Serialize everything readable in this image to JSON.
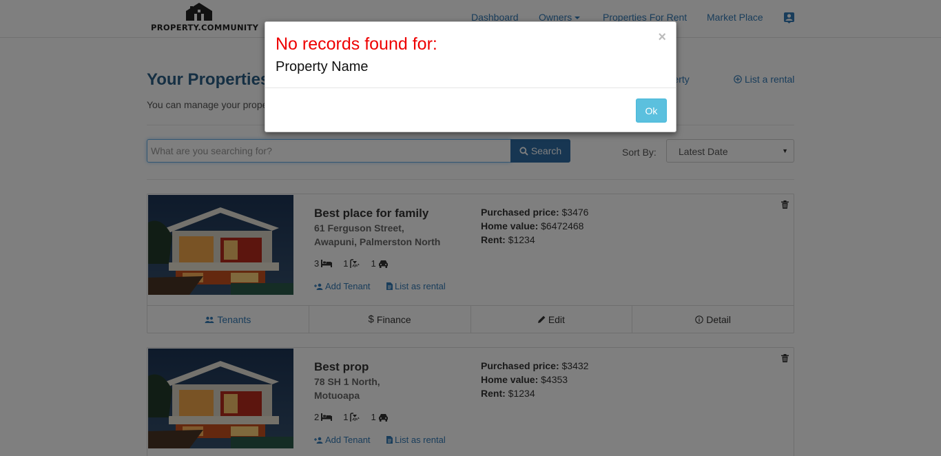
{
  "brand": {
    "logo_text": "PROPERTY.COMMUNITY"
  },
  "nav": {
    "dashboard": "Dashboard",
    "owners": "Owners",
    "properties_for_rent": "Properties For Rent",
    "market_place": "Market Place"
  },
  "header": {
    "title": "Your Properties",
    "subtitle": "You can manage your properties",
    "new_property": "New Property",
    "list_rental": "List a rental"
  },
  "search": {
    "placeholder": "What are you searching for?",
    "button": "Search",
    "sort_label": "Sort By:",
    "sort_value": "Latest Date"
  },
  "properties": [
    {
      "name": "Best place for family",
      "address_line1": "61 Ferguson Street,",
      "address_line2": "Awapuni, Palmerston North",
      "bedrooms": "3",
      "bathrooms": "1",
      "parking": "1",
      "add_tenant": "Add Tenant",
      "list_as_rental": "List as rental",
      "purchased_label": "Purchased price:",
      "purchased_value": "$3476",
      "home_value_label": "Home value:",
      "home_value": "$6472468",
      "rent_label": "Rent:",
      "rent_value": "$1234",
      "footer": {
        "tenants": "Tenants",
        "finance": "Finance",
        "edit": "Edit",
        "detail": "Detail"
      }
    },
    {
      "name": "Best prop",
      "address_line1": "78 SH 1 North,",
      "address_line2": "Motuoapa",
      "bedrooms": "2",
      "bathrooms": "1",
      "parking": "1",
      "add_tenant": "Add Tenant",
      "list_as_rental": "List as rental",
      "purchased_label": "Purchased price:",
      "purchased_value": "$3432",
      "home_value_label": "Home value:",
      "home_value": "$4353",
      "rent_label": "Rent:",
      "rent_value": "$1234"
    }
  ],
  "modal": {
    "title": "No records found for:",
    "body": "Property Name",
    "close": "×",
    "ok": "Ok"
  },
  "colors": {
    "accent": "#337ab7",
    "search_button": "#2e6da4",
    "ok_button": "#5bc0de",
    "alert_red": "#ee0000"
  }
}
